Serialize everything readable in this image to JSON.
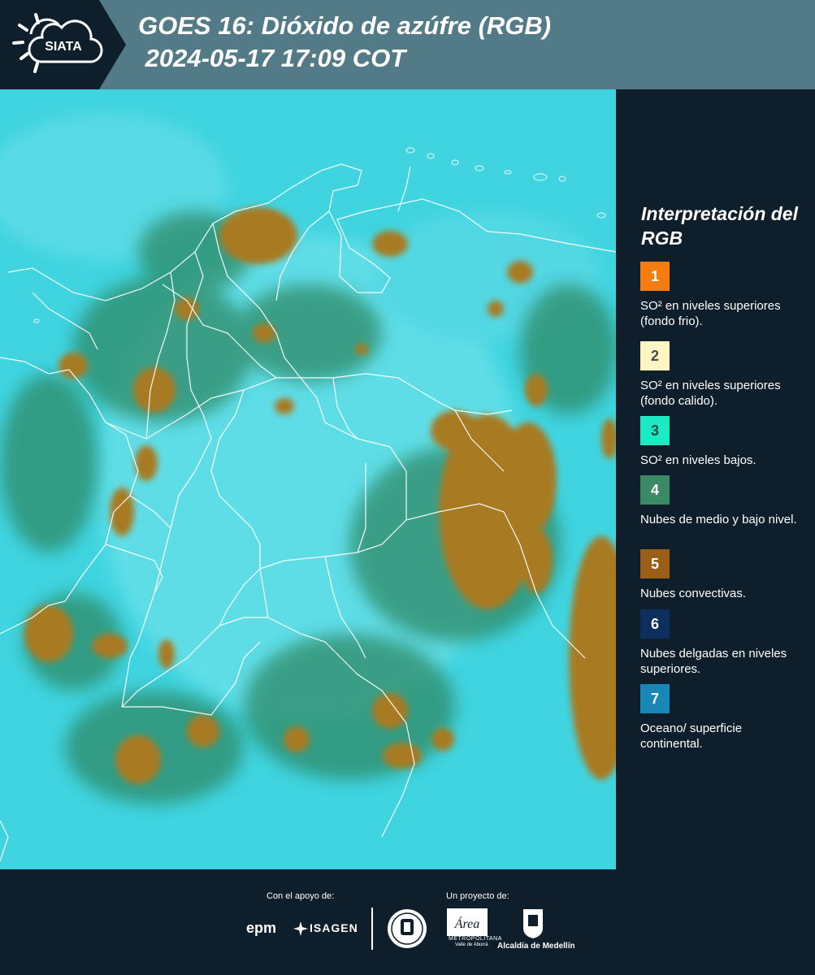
{
  "header": {
    "logo_text": "SIATA",
    "title_line1": "GOES 16: Dióxido de azúfre (RGB)",
    "title_line2": " 2024-05-17 17:09 COT",
    "colors": {
      "band": "#527a87",
      "logo_bg": "#0e1f2b"
    }
  },
  "legend": {
    "title": "Interpretación del RGB",
    "items": [
      {
        "number": "1",
        "color": "#f57c0e",
        "number_color": "#ffffff",
        "label": "SO² en niveles superiores (fondo frio)."
      },
      {
        "number": "2",
        "color": "#fdf6c3",
        "number_color": "#4a4a4a",
        "label": "SO² en niveles superiores (fondo calido)."
      },
      {
        "number": "3",
        "color": "#1de9c3",
        "number_color": "#2a4a44",
        "label": "SO² en niveles bajos."
      },
      {
        "number": "4",
        "color": "#3a8a66",
        "number_color": "#ffffff",
        "label": "Nubes de medio y bajo nivel."
      },
      {
        "number": "5",
        "color": "#9a5e16",
        "number_color": "#ffffff",
        "label": "Nubes convectivas."
      },
      {
        "number": "6",
        "color": "#0c2f5e",
        "number_color": "#ffffff",
        "label": "Nubes delgadas en niveles superiores."
      },
      {
        "number": "7",
        "color": "#1a86b6",
        "number_color": "#ffffff",
        "label": "Oceano/ superficie continental."
      }
    ]
  },
  "map": {
    "icon": "goes16-so2-rgb-satellite-map",
    "colors": {
      "ocean": "#3fd4e0",
      "convective": "#a0781e",
      "mid_low": "#2e7a58",
      "borders": "#ffffff"
    }
  },
  "footer": {
    "support_label": "Con el apoyo de:",
    "project_label": "Un proyecto de:",
    "sponsors": [
      "epm",
      "ISAGEN"
    ],
    "metro_lines": [
      "METROPOLITANA",
      "Valle de Aburrá"
    ],
    "alcaldia": "Alcaldía de Medellín"
  }
}
